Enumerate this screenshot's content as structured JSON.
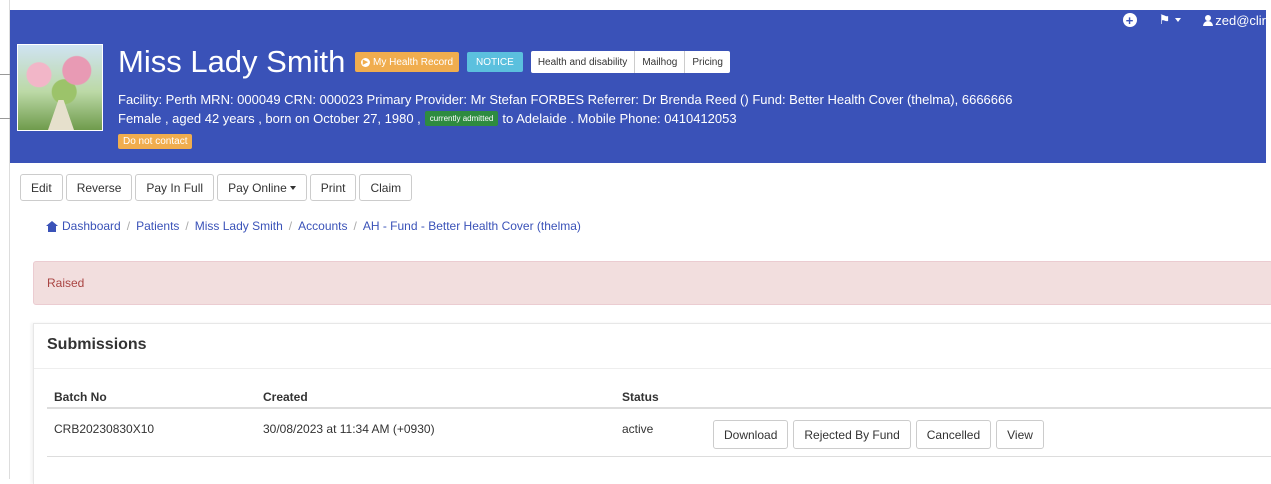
{
  "topnav": {
    "user": "zed@clir"
  },
  "patient": {
    "name": "Miss Lady Smith",
    "info_line1": "Facility: Perth   MRN: 000049   CRN: 000023   Primary Provider: Mr Stefan FORBES   Referrer: Dr Brenda Reed ()   Fund: Better Health Cover (thelma), 6666666",
    "info_line2_before": "Female , aged 42 years , born on October 27, 1980 ,",
    "admitted_badge": "currently admitted",
    "info_line2_after": "to Adelaide . Mobile Phone: 0410412053",
    "no_contact": "Do not contact"
  },
  "badges": {
    "my_health_record": "My Health Record",
    "notice": "NOTICE",
    "group": [
      "Health and disability",
      "Mailhog",
      "Pricing"
    ]
  },
  "actions": {
    "edit": "Edit",
    "reverse": "Reverse",
    "pay_in_full": "Pay In Full",
    "pay_online": "Pay Online",
    "print": "Print",
    "claim": "Claim"
  },
  "breadcrumb": [
    "Dashboard",
    "Patients",
    "Miss Lady Smith",
    "Accounts",
    "AH - Fund - Better Health Cover (thelma)"
  ],
  "alert": {
    "text": "Raised",
    "color": "#f2dede"
  },
  "submissions": {
    "title": "Submissions",
    "columns": [
      "Batch No",
      "Created",
      "Status"
    ],
    "rows": [
      {
        "batch_no": "CRB20230830X10",
        "created": "30/08/2023 at 11:34 AM (+0930)",
        "status": "active",
        "buttons": [
          "Download",
          "Rejected By Fund",
          "Cancelled",
          "View"
        ]
      }
    ]
  },
  "colors": {
    "header": "#3a52b8",
    "warning": "#f0ad4e",
    "info": "#5bc0de",
    "success": "#2e8b40"
  }
}
